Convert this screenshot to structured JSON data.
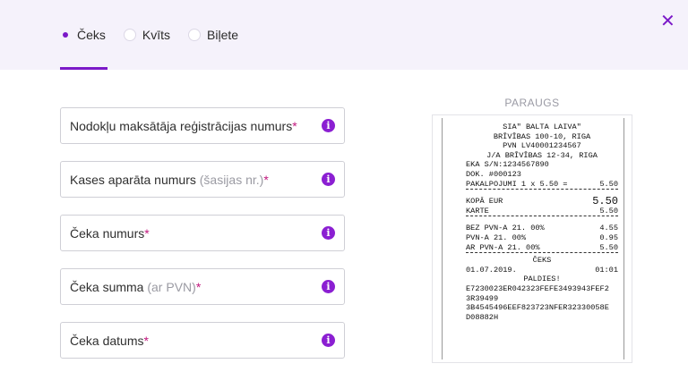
{
  "tabs": [
    {
      "label": "Čeks",
      "selected": true
    },
    {
      "label": "Kvīts",
      "selected": false
    },
    {
      "label": "Biļete",
      "selected": false
    }
  ],
  "fields": [
    {
      "label": "Nodokļu maksātāja reģistrācijas numurs",
      "hint": "",
      "required": "*"
    },
    {
      "label": "Kases aparāta numurs",
      "hint": "(šasijas nr.)",
      "required": "*"
    },
    {
      "label": "Čeka numurs",
      "hint": "",
      "required": "*"
    },
    {
      "label": "Čeka summa",
      "hint": "(ar PVN)",
      "required": "*"
    },
    {
      "label": "Čeka datums",
      "hint": "",
      "required": "*"
    }
  ],
  "info_icon_glyph": "i",
  "close_glyph": "✕",
  "sample": {
    "title": "PARAUGS",
    "receipt": {
      "company": "SIA\" BALTA LAIVA\"",
      "address1": "BRĪVĪBAS 100-10, RIGA",
      "pvn": "PVN LV40001234567",
      "address2": "J/A BRĪVĪBAS 12-34, RIGA",
      "eka": "EKA S/N:1234567890",
      "dok": "DOK. #000123",
      "service_label": "PAKALPOJUMI 1 x 5.50 =",
      "service_value": "5.50",
      "total_label": "KOPĀ EUR",
      "total_value": "5.50",
      "card_label": "KARTE",
      "card_value": "5.50",
      "vat_rows": [
        {
          "label": "BEZ PVN-A 21. 00%",
          "value": "4.55"
        },
        {
          "label": "PVN-A 21. 00%",
          "value": "0.95"
        },
        {
          "label": "AR PVN-A 21. 00%",
          "value": "5.50"
        }
      ],
      "type": "ČEKS",
      "date": "01.07.2019.",
      "time": "01:01",
      "thanks": "PALDIES!",
      "code1": "E7230023ER042323FEFE3493943FEF2",
      "code2": "3R39499",
      "code3": "3B4545496EEF823723NFER32330058E",
      "code4": "D08882H"
    }
  },
  "colors": {
    "accent": "#7b19c8",
    "required": "#c0177d",
    "header_bg": "#f5f2fb"
  }
}
